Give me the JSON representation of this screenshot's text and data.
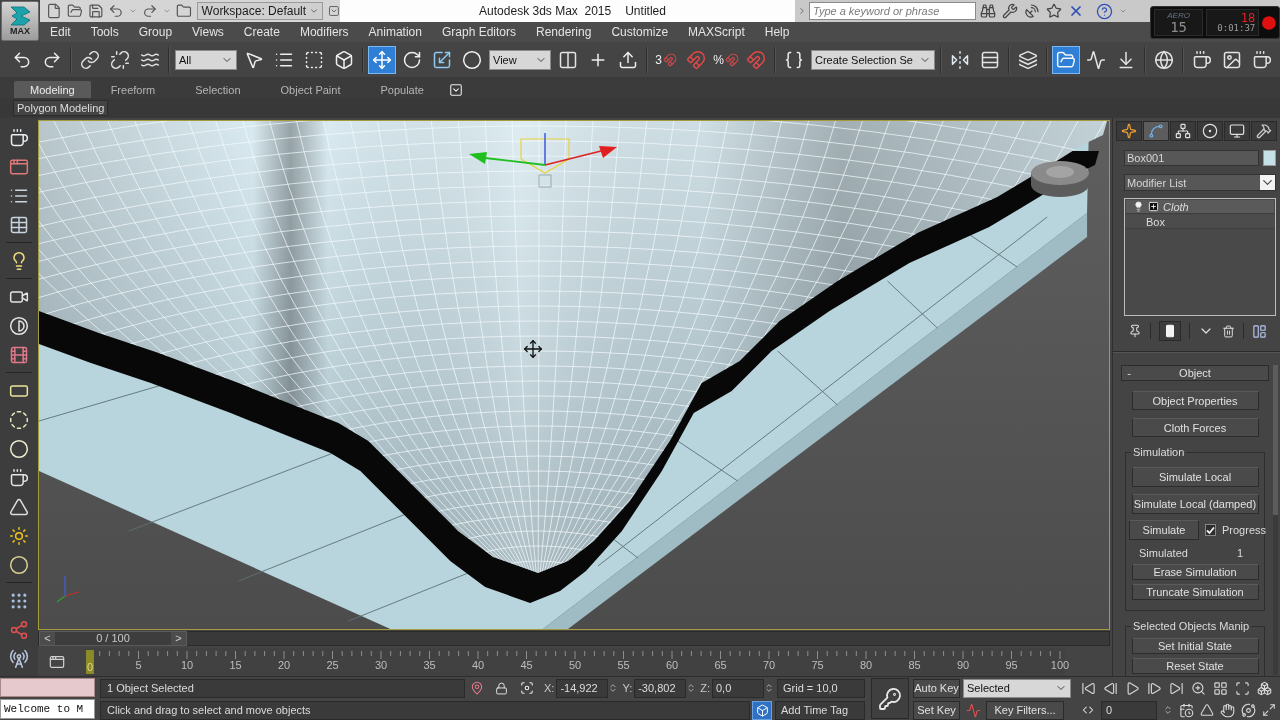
{
  "app_button": {
    "label": "MAX"
  },
  "title_bar": {
    "workspace": "Workspace: Default",
    "title": "Autodesk 3ds Max  2015",
    "document": "Untitled",
    "search": {
      "placeholder": "Type a keyword or phrase"
    }
  },
  "recorder_widget": {
    "mode": "AERO",
    "fps": "15",
    "counter": "18",
    "elapsed": "0:01:37"
  },
  "menu_bar": [
    "Edit",
    "Tools",
    "Group",
    "Views",
    "Create",
    "Modifiers",
    "Animation",
    "Graph Editors",
    "Rendering",
    "Customize",
    "MAXScript",
    "Help"
  ],
  "main_toolbar": [
    [
      {
        "kind": "undo",
        "active": false
      },
      {
        "kind": "redo",
        "active": false
      }
    ],
    [
      {
        "kind": "link",
        "active": false
      },
      {
        "kind": "unlink",
        "active": false
      },
      {
        "kind": "bind",
        "active": false
      }
    ],
    [
      {
        "kind": "dropdown",
        "value": "All"
      },
      {
        "kind": "select",
        "active": false
      },
      {
        "kind": "select_by_name",
        "active": false
      },
      {
        "kind": "region",
        "active": false
      },
      {
        "kind": "crossing",
        "active": false
      }
    ],
    [
      {
        "kind": "move",
        "active": true
      },
      {
        "kind": "rotate",
        "active": false
      },
      {
        "kind": "scale",
        "active": false
      },
      {
        "kind": "manipulate",
        "active": false
      },
      {
        "kind": "dropdown",
        "value": "View"
      },
      {
        "kind": "pivot",
        "active": false
      },
      {
        "kind": "transform",
        "active": false
      },
      {
        "kind": "override",
        "active": false
      }
    ],
    [
      {
        "kind": "snap",
        "prefix": "3",
        "active": false
      },
      {
        "kind": "angle_snap",
        "active": false
      },
      {
        "kind": "snap",
        "prefix": "%",
        "active": false
      },
      {
        "kind": "spinner_snap",
        "active": false
      }
    ],
    [
      {
        "kind": "named_sets",
        "active": false
      },
      {
        "kind": "dropdown",
        "value": "Create Selection Se"
      }
    ],
    [
      {
        "kind": "mirror",
        "active": false
      },
      {
        "kind": "align",
        "active": false
      }
    ],
    [
      {
        "kind": "layers",
        "active": false
      }
    ],
    [
      {
        "kind": "scene_explorer",
        "active": true
      },
      {
        "kind": "curve_editor",
        "active": false
      },
      {
        "kind": "schematic",
        "active": false
      }
    ],
    [
      {
        "kind": "material_editor",
        "active": false
      }
    ],
    [
      {
        "kind": "render_setup",
        "active": false
      },
      {
        "kind": "frame_window",
        "active": false
      },
      {
        "kind": "render",
        "active": false
      }
    ]
  ],
  "ribbon": {
    "tabs": [
      {
        "label": "Modeling",
        "selected": true
      },
      {
        "label": "Freeform",
        "selected": false
      },
      {
        "label": "Selection",
        "selected": false
      },
      {
        "label": "Object Paint",
        "selected": false
      },
      {
        "label": "Populate",
        "selected": false
      }
    ],
    "panel": "Polygon Modeling"
  },
  "time_slider": {
    "previous": "<",
    "position": "0 / 100",
    "next": ">",
    "level": 0
  },
  "track_bar": {
    "ticks": [
      {
        "label": "0",
        "selected": true
      },
      {
        "label": "5",
        "selected": false
      },
      {
        "label": "10",
        "selected": false
      },
      {
        "label": "15",
        "selected": false
      },
      {
        "label": "20",
        "selected": false
      },
      {
        "label": "25",
        "selected": false
      },
      {
        "label": "30",
        "selected": false
      },
      {
        "label": "35",
        "selected": false
      },
      {
        "label": "40",
        "selected": false
      },
      {
        "label": "45",
        "selected": false
      },
      {
        "label": "50",
        "selected": false
      },
      {
        "label": "55",
        "selected": false
      },
      {
        "label": "60",
        "selected": false
      },
      {
        "label": "65",
        "selected": false
      },
      {
        "label": "70",
        "selected": false
      },
      {
        "label": "75",
        "selected": false
      },
      {
        "label": "80",
        "selected": false
      },
      {
        "label": "85",
        "selected": false
      },
      {
        "label": "90",
        "selected": false
      },
      {
        "label": "95",
        "selected": false
      },
      {
        "label": "100",
        "selected": false
      }
    ]
  },
  "command_panel": {
    "tabs": [
      {
        "kind": "create",
        "selected": false
      },
      {
        "kind": "modify",
        "selected": true
      },
      {
        "kind": "hierarchy",
        "selected": false
      },
      {
        "kind": "motion",
        "selected": false
      },
      {
        "kind": "display",
        "selected": false
      },
      {
        "kind": "utilities",
        "selected": false
      }
    ],
    "object_name": "Box001",
    "modifier_list": "Modifier List",
    "modifier_stack": [
      {
        "kind": "modifier",
        "label": "Cloth",
        "expanded": false,
        "selected": true
      },
      {
        "kind": "base",
        "label": "Box",
        "selected": false
      }
    ],
    "rollout": {
      "toggle": "-",
      "title": "Object",
      "buttons": [
        "Object Properties",
        "Cloth Forces"
      ],
      "groups": [
        {
          "title": "Simulation",
          "items": [
            {
              "kind": "button",
              "label": "Simulate Local"
            },
            {
              "kind": "button",
              "label": "Simulate Local (damped)"
            },
            {
              "kind": "button_check",
              "label": "Simulate",
              "check_label": "Progress",
              "checked": true
            },
            {
              "kind": "readout",
              "label": "Simulated",
              "value": "1"
            },
            {
              "kind": "button",
              "label": "Erase Simulation"
            },
            {
              "kind": "button",
              "label": "Truncate Simulation"
            }
          ]
        },
        {
          "title": "Selected Objects Manip",
          "items": [
            {
              "kind": "button",
              "label": "Set Initial State"
            },
            {
              "kind": "button",
              "label": "Reset State"
            }
          ]
        }
      ]
    }
  },
  "status_bar": {
    "listener": {
      "output": "Welcome to M"
    },
    "selection": "1 Object Selected",
    "prompt": "Click and drag to select and move objects",
    "coordinates": [
      {
        "label": "X:",
        "value": "-14,922"
      },
      {
        "label": "Y:",
        "value": "-30,802"
      },
      {
        "label": "Z:",
        "value": "0,0"
      }
    ],
    "grid": "Grid = 10,0",
    "time_tag": "Add Time Tag",
    "auto_key": {
      "label": "Auto Key",
      "on": false
    },
    "key_mode": "Selected",
    "set_key": "Set Key",
    "key_filters": "Key Filters...",
    "current_frame": "0"
  }
}
